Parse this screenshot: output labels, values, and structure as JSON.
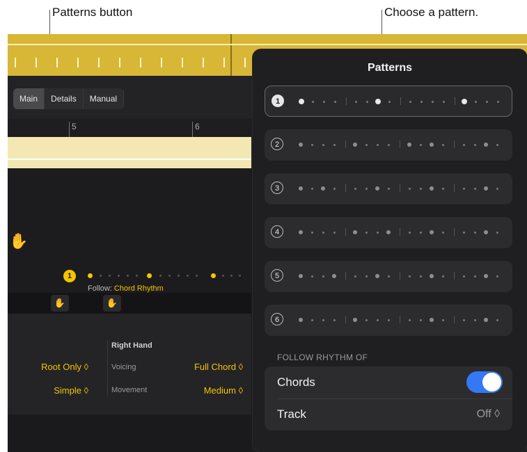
{
  "callouts": {
    "left": "Patterns button",
    "right": "Choose a pattern."
  },
  "toolbar": {
    "tabs": [
      "Main",
      "Details",
      "Manual"
    ],
    "active_tab": "Main"
  },
  "ruler": {
    "markers": [
      "5",
      "6"
    ]
  },
  "pattern_button": {
    "number": "1",
    "follow_label": "Follow:",
    "follow_value": "Chord Rhythm"
  },
  "params": {
    "left_voicing_value": "Root Only ◊",
    "left_movement_value": "Simple ◊",
    "right_hand_header": "Right Hand",
    "voicing_label": "Voicing",
    "movement_label": "Movement",
    "right_voicing_value": "Full Chord ◊",
    "right_movement_value": "Medium ◊"
  },
  "patterns_panel": {
    "title": "Patterns",
    "selected": 1,
    "patterns": [
      {
        "number": "1",
        "dots": [
          "b",
          "s",
          "s",
          "s",
          "|",
          "s",
          "s",
          "b",
          "s",
          "|",
          "s",
          "s",
          "s",
          "s",
          "|",
          "b",
          "s",
          "s",
          "s"
        ]
      },
      {
        "number": "2",
        "dots": [
          "m",
          "s",
          "s",
          "s",
          "|",
          "m",
          "s",
          "s",
          "s",
          "|",
          "m",
          "s",
          "m",
          "s",
          "|",
          "s",
          "s",
          "m",
          "s"
        ]
      },
      {
        "number": "3",
        "dots": [
          "m",
          "s",
          "m",
          "s",
          "|",
          "s",
          "s",
          "m",
          "s",
          "|",
          "s",
          "s",
          "m",
          "s",
          "|",
          "s",
          "s",
          "m",
          "s"
        ]
      },
      {
        "number": "4",
        "dots": [
          "m",
          "s",
          "s",
          "s",
          "|",
          "m",
          "s",
          "s",
          "m",
          "|",
          "s",
          "s",
          "m",
          "s",
          "|",
          "s",
          "s",
          "m",
          "s"
        ]
      },
      {
        "number": "5",
        "dots": [
          "m",
          "s",
          "s",
          "m",
          "|",
          "s",
          "s",
          "m",
          "s",
          "|",
          "s",
          "s",
          "m",
          "s",
          "|",
          "s",
          "s",
          "m",
          "s"
        ]
      },
      {
        "number": "6",
        "dots": [
          "m",
          "s",
          "s",
          "s",
          "|",
          "m",
          "s",
          "s",
          "s",
          "|",
          "s",
          "s",
          "m",
          "s",
          "|",
          "s",
          "s",
          "m",
          "s"
        ]
      }
    ],
    "section_header": "FOLLOW RHYTHM OF",
    "chords_label": "Chords",
    "chords_on": true,
    "track_label": "Track",
    "track_value": "Off ◊"
  },
  "colors": {
    "accent_yellow": "#f5c400",
    "toggle_blue": "#3478f6",
    "panel_bg": "#1f1f21"
  }
}
